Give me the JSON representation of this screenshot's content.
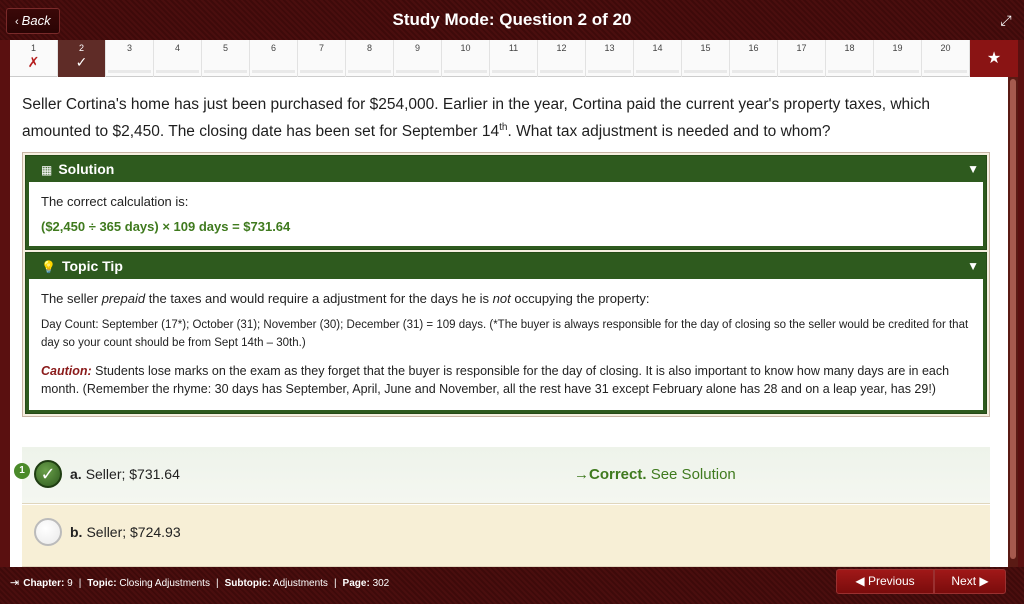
{
  "header": {
    "back_label": "Back",
    "title": "Study Mode: Question 2 of 20"
  },
  "qnav": {
    "items": [
      {
        "num": "1",
        "mark": "✗"
      },
      {
        "num": "2",
        "mark": "✓"
      },
      {
        "num": "3",
        "mark": ""
      },
      {
        "num": "4",
        "mark": ""
      },
      {
        "num": "5",
        "mark": ""
      },
      {
        "num": "6",
        "mark": ""
      },
      {
        "num": "7",
        "mark": ""
      },
      {
        "num": "8",
        "mark": ""
      },
      {
        "num": "9",
        "mark": ""
      },
      {
        "num": "10",
        "mark": ""
      },
      {
        "num": "11",
        "mark": ""
      },
      {
        "num": "12",
        "mark": ""
      },
      {
        "num": "13",
        "mark": ""
      },
      {
        "num": "14",
        "mark": ""
      },
      {
        "num": "15",
        "mark": ""
      },
      {
        "num": "16",
        "mark": ""
      },
      {
        "num": "17",
        "mark": ""
      },
      {
        "num": "18",
        "mark": ""
      },
      {
        "num": "19",
        "mark": ""
      },
      {
        "num": "20",
        "mark": ""
      }
    ],
    "star": "★"
  },
  "question": {
    "text_before_sup": "Seller Cortina's home has just been purchased for $254,000. Earlier in the year, Cortina paid the current year's property taxes, which amounted to $2,450. The closing date has been set for September 14",
    "sup": "th",
    "text_after_sup": ". What tax adjustment is needed and to whom?"
  },
  "solution": {
    "heading": "Solution",
    "intro": "The correct calculation is:",
    "calc": "($2,450 ÷ 365 days) × 109 days = $731.64"
  },
  "topic_tip": {
    "heading": "Topic Tip",
    "line1_a": "The seller ",
    "line1_prepaid": "prepaid",
    "line1_b": " the taxes and would require a adjustment for the days he is ",
    "line1_not": "not",
    "line1_c": " occupying the property:",
    "day_count": "Day Count: September (17*); October (31); November (30); December (31) = 109 days. (*The buyer is always responsible for the day of closing so the seller would be credited for that day so your count should be from Sept 14th – 30th.)",
    "caution_label": "Caution:",
    "caution_text": " Students lose marks on the exam as they forget that the buyer is responsible for the day of closing. It is also important to know how many days are in each month. (Remember the rhyme: 30 days has September, April, June and November, all the rest have 31 except February alone has 28 and on a leap year, has 29!)"
  },
  "answers": [
    {
      "letter": "a.",
      "text": "Seller; $731.64",
      "feedback_strong": "Correct.",
      "feedback_link": "See Solution",
      "badge": "1"
    },
    {
      "letter": "b.",
      "text": "Seller; $724.93"
    }
  ],
  "footer": {
    "chapter_label": "Chapter:",
    "chapter_value": "9",
    "topic_label": "Topic:",
    "topic_value": "Closing Adjustments",
    "subtopic_label": "Subtopic:",
    "subtopic_value": "Adjustments",
    "page_label": "Page:",
    "page_value": "302",
    "prev_label": "Previous",
    "next_label": "Next"
  },
  "colors": {
    "brand": "#5a1010",
    "panel_green": "#2e5a1e",
    "accent_green": "#3f7a1e",
    "wrong_red": "#b51c1c"
  }
}
